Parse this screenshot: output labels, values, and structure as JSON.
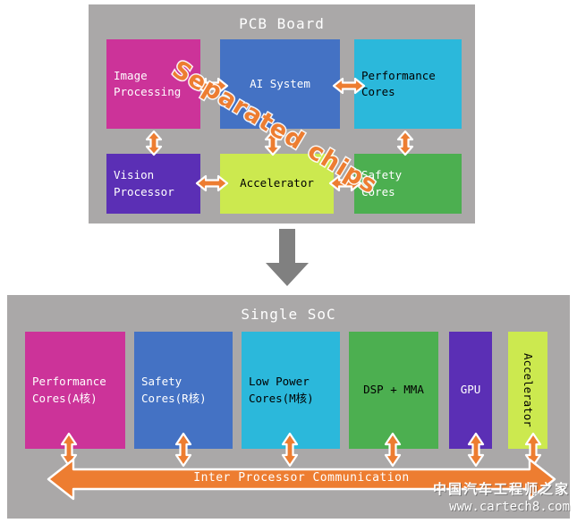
{
  "page": {
    "background": "#ffffff",
    "panel_bg": "#aaa8a8",
    "arrow_color": "#ED7D31",
    "arrow_outline": "#ffffff",
    "transition_arrow_color": "#808080"
  },
  "pcb": {
    "title": "PCB Board",
    "overlay_text": "Separated chips",
    "blocks": [
      {
        "label": "Image\nProcessing",
        "color": "#CC3399",
        "text_color": "#ffffff"
      },
      {
        "label": "AI System",
        "color": "#4472C4",
        "text_color": "#ffffff"
      },
      {
        "label": "Performance\nCores",
        "color": "#2BB8DB",
        "text_color": "#000000"
      },
      {
        "label": "Vision\nProcessor",
        "color": "#5B2FB5",
        "text_color": "#ffffff"
      },
      {
        "label": "Accelerator",
        "color": "#CCE94F",
        "text_color": "#000000"
      },
      {
        "label": "Safety\nCores",
        "color": "#4CAF50",
        "text_color": "#ffffff"
      }
    ]
  },
  "transition": {
    "icon": "down-arrow-icon"
  },
  "soc": {
    "title": "Single SoC",
    "bus_label": "Inter Processor Communication",
    "blocks": [
      {
        "label": "Performance\nCores(A核)",
        "color": "#CC3399",
        "text_color": "#ffffff",
        "orientation": "horizontal"
      },
      {
        "label": "Safety\nCores(R核)",
        "color": "#4472C4",
        "text_color": "#ffffff",
        "orientation": "horizontal"
      },
      {
        "label": "Low Power\nCores(M核)",
        "color": "#2BB8DB",
        "text_color": "#000000",
        "orientation": "horizontal"
      },
      {
        "label": "DSP + MMA",
        "color": "#4CAF50",
        "text_color": "#000000",
        "orientation": "horizontal"
      },
      {
        "label": "GPU",
        "color": "#5B2FB5",
        "text_color": "#ffffff",
        "orientation": "horizontal"
      },
      {
        "label": "Accelerator",
        "color": "#CCE94F",
        "text_color": "#000000",
        "orientation": "vertical"
      }
    ]
  },
  "watermark": {
    "chinese": "中国汽车工程师之家",
    "url": "www.cartech8.com"
  }
}
